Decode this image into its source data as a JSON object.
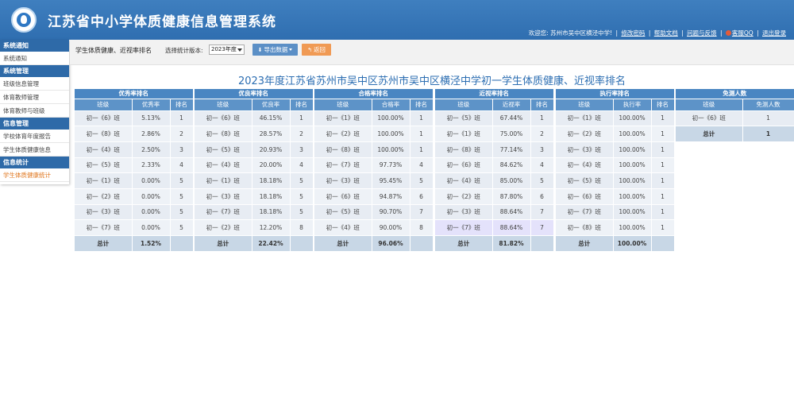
{
  "header": {
    "title": "江苏省中小学体质健康信息管理系统",
    "welcome": "欢迎您: 苏州市吴中区横泾中学!",
    "links": [
      "修改密码",
      "帮助文档",
      "问题与反馈"
    ],
    "qq": "客服QQ",
    "logout": "退出登录"
  },
  "sidebar": {
    "groups": [
      {
        "title": "系统通知",
        "items": [
          "系统通知"
        ]
      },
      {
        "title": "系统管理",
        "items": [
          "班级信息管理",
          "体育教师管理",
          "体育教师与班级"
        ]
      },
      {
        "title": "信息管理",
        "items": [
          "学校体育年度报告",
          "学生体质健康信息"
        ]
      },
      {
        "title": "信息统计",
        "items": [
          "学生体质健康统计"
        ]
      }
    ]
  },
  "toolbar": {
    "title": "学生体质健康、近视率排名",
    "version_label": "选择统计版本:",
    "version_value": "2023年度",
    "export_label": "导出数据",
    "back_label": "返回"
  },
  "main": {
    "title": "2023年度江苏省苏州市吴中区苏州市吴中区横泾中学初一学生体质健康、近视率排名"
  },
  "tables": [
    {
      "caption": "优秀率排名",
      "headers": [
        "班级",
        "优秀率",
        "排名"
      ],
      "rows": [
        [
          "初一《6》班",
          "5.13%",
          "1"
        ],
        [
          "初一《8》班",
          "2.86%",
          "2"
        ],
        [
          "初一《4》班",
          "2.50%",
          "3"
        ],
        [
          "初一《5》班",
          "2.33%",
          "4"
        ],
        [
          "初一《1》班",
          "0.00%",
          "5"
        ],
        [
          "初一《2》班",
          "0.00%",
          "5"
        ],
        [
          "初一《3》班",
          "0.00%",
          "5"
        ],
        [
          "初一《7》班",
          "0.00%",
          "5"
        ]
      ],
      "total": [
        "总计",
        "1.52%",
        ""
      ]
    },
    {
      "caption": "优良率排名",
      "headers": [
        "班级",
        "优良率",
        "排名"
      ],
      "rows": [
        [
          "初一《6》班",
          "46.15%",
          "1"
        ],
        [
          "初一《8》班",
          "28.57%",
          "2"
        ],
        [
          "初一《5》班",
          "20.93%",
          "3"
        ],
        [
          "初一《4》班",
          "20.00%",
          "4"
        ],
        [
          "初一《1》班",
          "18.18%",
          "5"
        ],
        [
          "初一《3》班",
          "18.18%",
          "5"
        ],
        [
          "初一《7》班",
          "18.18%",
          "5"
        ],
        [
          "初一《2》班",
          "12.20%",
          "8"
        ]
      ],
      "total": [
        "总计",
        "22.42%",
        ""
      ]
    },
    {
      "caption": "合格率排名",
      "headers": [
        "班级",
        "合格率",
        "排名"
      ],
      "rows": [
        [
          "初一《1》班",
          "100.00%",
          "1"
        ],
        [
          "初一《2》班",
          "100.00%",
          "1"
        ],
        [
          "初一《8》班",
          "100.00%",
          "1"
        ],
        [
          "初一《7》班",
          "97.73%",
          "4"
        ],
        [
          "初一《3》班",
          "95.45%",
          "5"
        ],
        [
          "初一《6》班",
          "94.87%",
          "6"
        ],
        [
          "初一《5》班",
          "90.70%",
          "7"
        ],
        [
          "初一《4》班",
          "90.00%",
          "8"
        ]
      ],
      "total": [
        "总计",
        "96.06%",
        ""
      ]
    },
    {
      "caption": "近视率排名",
      "headers": [
        "班级",
        "近视率",
        "排名"
      ],
      "rows": [
        [
          "初一《5》班",
          "67.44%",
          "1"
        ],
        [
          "初一《1》班",
          "75.00%",
          "2"
        ],
        [
          "初一《8》班",
          "77.14%",
          "3"
        ],
        [
          "初一《6》班",
          "84.62%",
          "4"
        ],
        [
          "初一《4》班",
          "85.00%",
          "5"
        ],
        [
          "初一《2》班",
          "87.80%",
          "6"
        ],
        [
          "初一《3》班",
          "88.64%",
          "7"
        ],
        [
          "初一《7》班",
          "88.64%",
          "7"
        ]
      ],
      "highlight_row": 7,
      "total": [
        "总计",
        "81.82%",
        ""
      ]
    },
    {
      "caption": "执行率排名",
      "headers": [
        "班级",
        "执行率",
        "排名"
      ],
      "rows": [
        [
          "初一《1》班",
          "100.00%",
          "1"
        ],
        [
          "初一《2》班",
          "100.00%",
          "1"
        ],
        [
          "初一《3》班",
          "100.00%",
          "1"
        ],
        [
          "初一《4》班",
          "100.00%",
          "1"
        ],
        [
          "初一《5》班",
          "100.00%",
          "1"
        ],
        [
          "初一《6》班",
          "100.00%",
          "1"
        ],
        [
          "初一《7》班",
          "100.00%",
          "1"
        ],
        [
          "初一《8》班",
          "100.00%",
          "1"
        ]
      ],
      "total": [
        "总计",
        "100.00%",
        ""
      ]
    },
    {
      "caption": "免测人数",
      "headers": [
        "班级",
        "免测人数"
      ],
      "rows": [
        [
          "初一《6》班",
          "1"
        ]
      ],
      "total": [
        "总计",
        "1"
      ]
    }
  ]
}
